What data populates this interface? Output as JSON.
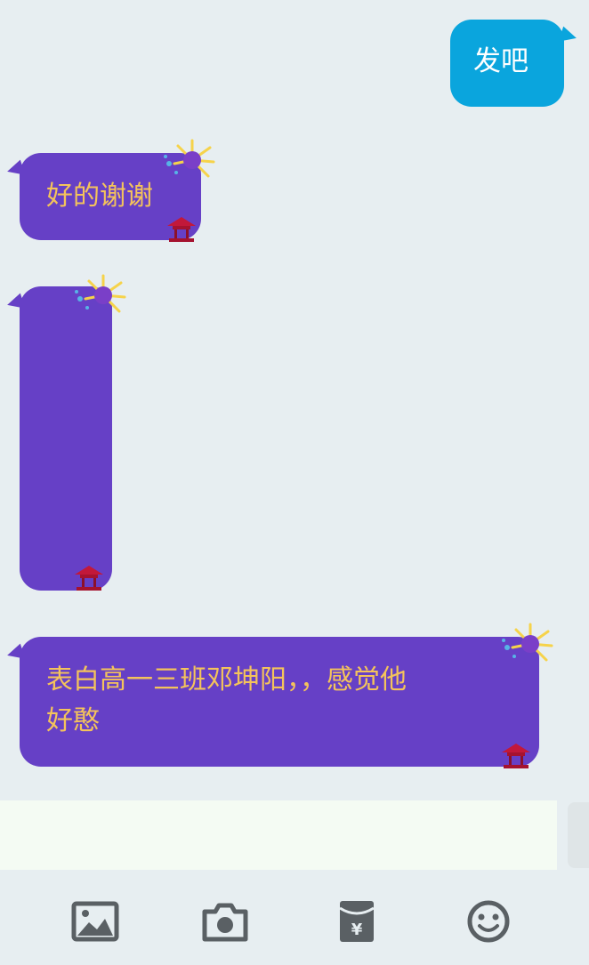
{
  "messages": [
    {
      "direction": "out",
      "text": "发吧"
    },
    {
      "direction": "in",
      "text": "好的谢谢"
    },
    {
      "direction": "in",
      "text": ""
    },
    {
      "direction": "in",
      "text": "表白高一三班邓坤阳，，感觉他\n好憨"
    }
  ],
  "input": {
    "value": ""
  },
  "toolbar": {
    "icons": [
      "image-icon",
      "camera-icon",
      "red-packet-icon",
      "emoji-icon"
    ]
  },
  "colors": {
    "background": "#e7eef1",
    "outgoing_bubble": "#0aa5dd",
    "incoming_bubble": "#6640c6",
    "incoming_text": "#f4c35b",
    "icon": "#5a6064"
  }
}
